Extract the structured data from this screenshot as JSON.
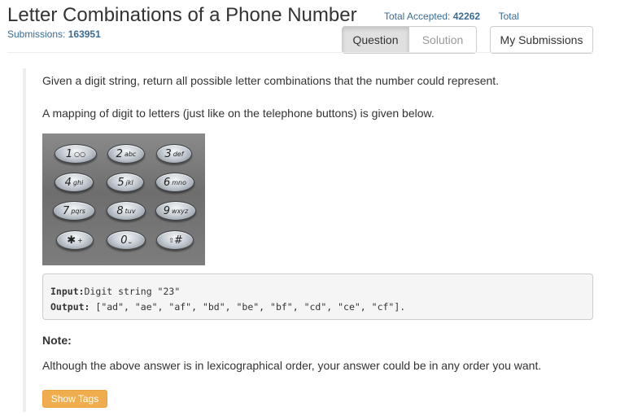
{
  "header": {
    "title": "Letter Combinations of a Phone Number",
    "total_accepted_label": "Total Accepted:",
    "total_accepted_value": "42262",
    "total_submissions_label": "Total",
    "submissions_label": "Submissions:",
    "submissions_value": "163951"
  },
  "tabs": {
    "question": "Question",
    "solution": "Solution",
    "my_submissions": "My Submissions"
  },
  "problem": {
    "intro": "Given a digit string, return all possible letter combinations that the number could represent.",
    "mapping": "A mapping of digit to letters (just like on the telephone buttons) is given below.",
    "keys": [
      {
        "digit": "1",
        "letters": "○○"
      },
      {
        "digit": "2",
        "letters": "abc"
      },
      {
        "digit": "3",
        "letters": "def"
      },
      {
        "digit": "4",
        "letters": "ghi"
      },
      {
        "digit": "5",
        "letters": "jkl"
      },
      {
        "digit": "6",
        "letters": "mno"
      },
      {
        "digit": "7",
        "letters": "pqrs"
      },
      {
        "digit": "8",
        "letters": "tuv"
      },
      {
        "digit": "9",
        "letters": "wxyz"
      },
      {
        "digit": "✱",
        "letters": "+"
      },
      {
        "digit": "0",
        "letters": "⎵"
      },
      {
        "digit": "#",
        "letters": "⇧"
      }
    ],
    "example": {
      "input_label": "Input:",
      "input_value": "Digit string \"23\"",
      "output_label": "Output:",
      "output_value": " [\"ad\", \"ae\", \"af\", \"bd\", \"be\", \"bf\", \"cd\", \"ce\", \"cf\"]."
    },
    "note_label": "Note:",
    "note_text": "Although the above answer is in lexicographical order, your answer could be in any order you want.",
    "show_tags": "Show Tags"
  },
  "colors": {
    "link": "#3a6b92",
    "tags_button": "#f0ad4e"
  }
}
